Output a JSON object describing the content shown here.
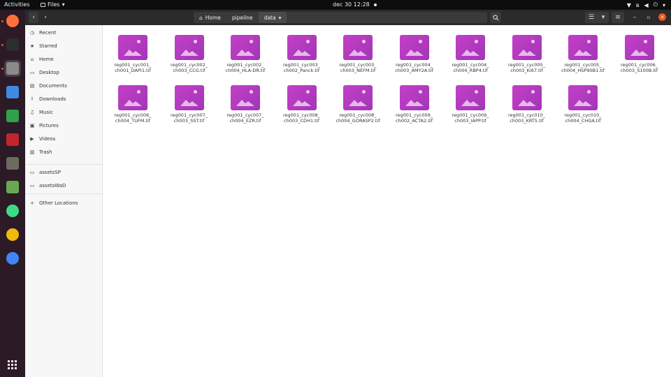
{
  "topbar": {
    "activities": "Activities",
    "app_name": "Files",
    "datetime": "dec 30  12:28"
  },
  "dock": {
    "items": [
      {
        "name": "firefox-icon",
        "color": "#ff7139"
      },
      {
        "name": "terminal-icon",
        "color": "#2d2d2d"
      },
      {
        "name": "files-icon",
        "color": "#8a8a8a"
      },
      {
        "name": "text-editor-icon",
        "color": "#3f8ae0"
      },
      {
        "name": "spreadsheet-icon",
        "color": "#2fa14b"
      },
      {
        "name": "filezilla-icon",
        "color": "#c0262c"
      },
      {
        "name": "gimp-icon",
        "color": "#6b6b5f"
      },
      {
        "name": "installer-icon",
        "color": "#6aa84f"
      },
      {
        "name": "android-studio-icon",
        "color": "#3ddc84"
      },
      {
        "name": "rhythmbox-icon",
        "color": "#f0b90b"
      },
      {
        "name": "chrome-icon",
        "color": "#4285f4"
      }
    ],
    "apps_grid": "show-apps-icon"
  },
  "headerbar": {
    "back": "‹",
    "forward": "›",
    "path": [
      {
        "label": "Home",
        "icon": "home-icon"
      },
      {
        "label": "pipeline"
      },
      {
        "label": "data",
        "current": true
      }
    ],
    "search_icon": "search-icon"
  },
  "sidebar": {
    "items": [
      {
        "label": "Recent",
        "icon": "clock-icon"
      },
      {
        "label": "Starred",
        "icon": "star-icon"
      },
      {
        "label": "Home",
        "icon": "home-icon"
      },
      {
        "label": "Desktop",
        "icon": "desktop-icon"
      },
      {
        "label": "Documents",
        "icon": "document-icon"
      },
      {
        "label": "Downloads",
        "icon": "download-icon"
      },
      {
        "label": "Music",
        "icon": "music-icon"
      },
      {
        "label": "Pictures",
        "icon": "picture-icon"
      },
      {
        "label": "Videos",
        "icon": "video-icon"
      },
      {
        "label": "Trash",
        "icon": "trash-icon"
      }
    ],
    "bookmarks": [
      {
        "label": "assetsSP",
        "icon": "folder-icon"
      },
      {
        "label": "assetsWaD",
        "icon": "folder-icon"
      }
    ],
    "other": {
      "label": "Other Locations",
      "icon": "plus-icon"
    }
  },
  "files": [
    {
      "l1": "reg001_cyc001_",
      "l2": "ch001_DAPI1.tif"
    },
    {
      "l1": "reg001_cyc002_",
      "l2": "ch003_CCG.tif"
    },
    {
      "l1": "reg001_cyc002_",
      "l2": "ch004_HLA-DR.tif"
    },
    {
      "l1": "reg001_cyc003_",
      "l2": "ch002_Panck.tif"
    },
    {
      "l1": "reg001_cyc003_",
      "l2": "ch003_NEFM.tif"
    },
    {
      "l1": "reg001_cyc004_",
      "l2": "ch003_AMY2A.tif"
    },
    {
      "l1": "reg001_cyc004_",
      "l2": "ch004_RBP4.tif"
    },
    {
      "l1": "reg001_cyc005_",
      "l2": "ch003_Ki67.tif"
    },
    {
      "l1": "reg001_cyc005_",
      "l2": "ch004_HSP90B1.tif"
    },
    {
      "l1": "reg001_cyc006_",
      "l2": "ch003_S100B.tif"
    },
    {
      "l1": "reg001_cyc006_",
      "l2": "ch004_TUFM.tif"
    },
    {
      "l1": "reg001_cyc007_",
      "l2": "ch003_SST.tif"
    },
    {
      "l1": "reg001_cyc007_",
      "l2": "ch004_EZR.tif"
    },
    {
      "l1": "reg001_cyc008_",
      "l2": "ch003_CDH1.tif"
    },
    {
      "l1": "reg001_cyc008_",
      "l2": "ch004_GORASP2.tif"
    },
    {
      "l1": "reg001_cyc009_",
      "l2": "ch002_ACTA2.tif"
    },
    {
      "l1": "reg001_cyc009_",
      "l2": "ch003_IAPP.tif"
    },
    {
      "l1": "reg001_cyc010_",
      "l2": "ch003_KRT5.tif"
    },
    {
      "l1": "reg001_cyc010_",
      "l2": "ch004_CHGA.tif"
    }
  ]
}
